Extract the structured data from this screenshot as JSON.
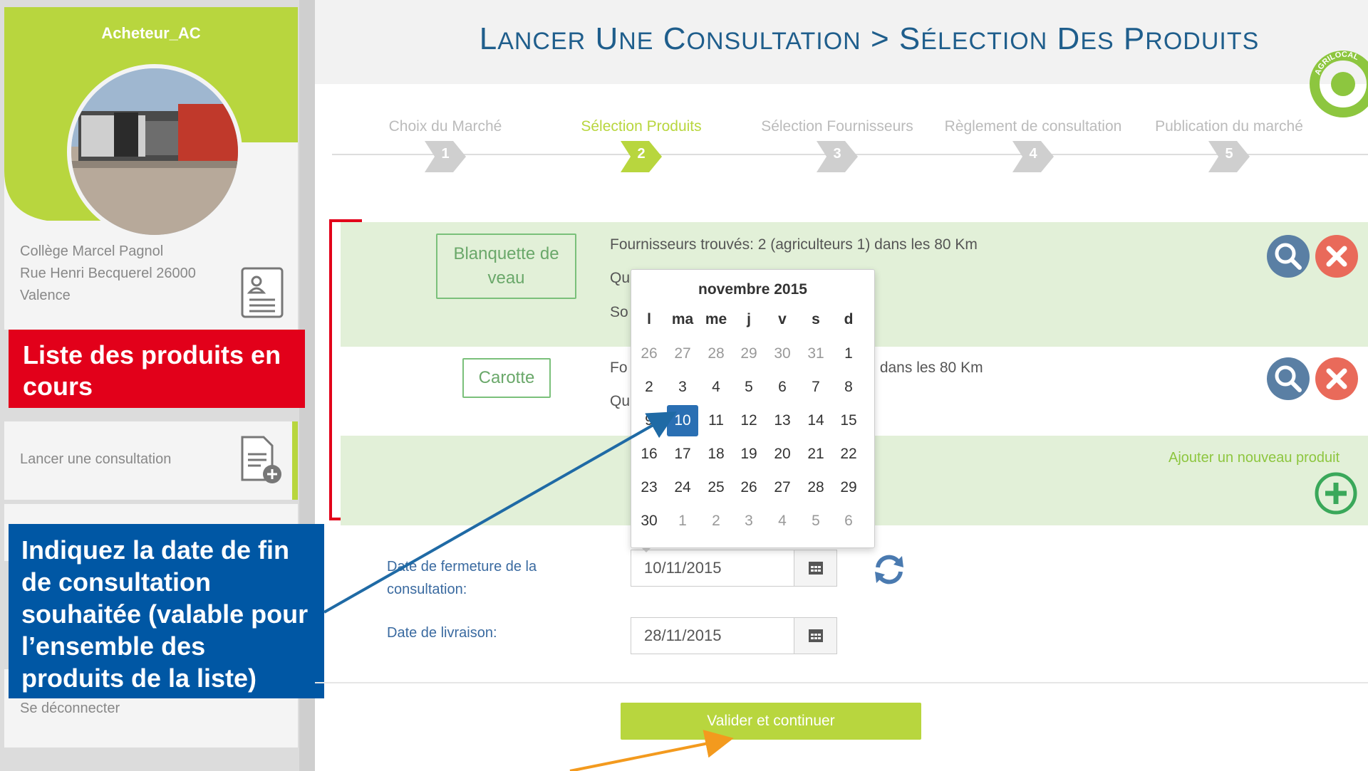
{
  "sidebar": {
    "user_name": "Acheteur_AC",
    "address_lines": [
      "Collège Marcel Pagnol",
      "Rue Henri Becquerel 26000",
      "Valence"
    ],
    "banner_text": "Liste des produits en cours",
    "nav_consult_label": "Lancer une consultation",
    "logout_label": "Se déconnecter"
  },
  "callout_text": "Indiquez la date de fin de consultation souhaitée (valable pour l’ensemble des produits de la liste)",
  "header": {
    "title_part1": "Lancer une consultation",
    "title_separator": ">",
    "title_part2": "Sélection des produits",
    "logo_text": "AGRILOCAL"
  },
  "stepper": [
    {
      "label": "Choix du Marché",
      "num": "1",
      "active": false
    },
    {
      "label": "Sélection Produits",
      "num": "2",
      "active": true
    },
    {
      "label": "Sélection Fournisseurs",
      "num": "3",
      "active": false
    },
    {
      "label": "Règlement de consultation",
      "num": "4",
      "active": false
    },
    {
      "label": "Publication du marché",
      "num": "5",
      "active": false
    }
  ],
  "products": [
    {
      "name": "Blanquette de veau",
      "suppliers": "Fournisseurs trouvés: 2 (agriculteurs 1) dans les 80 Km",
      "line2": "Qu",
      "line3": "So"
    },
    {
      "name": "Carotte",
      "suppliers_start": "Fo",
      "suppliers_end": ") dans les 80 Km",
      "line2": "Qu"
    }
  ],
  "add_product_label": "Ajouter un nouveau produit",
  "form": {
    "close_date_label": "Date de fermeture de la consultation:",
    "close_date_value": "10/11/2015",
    "delivery_date_label": "Date de livraison:",
    "delivery_date_value": "28/11/2015",
    "submit_label": "Valider et continuer"
  },
  "calendar": {
    "month": "novembre 2015",
    "weekdays": [
      "l",
      "ma",
      "me",
      "j",
      "v",
      "s",
      "d"
    ],
    "weeks": [
      [
        "26",
        "27",
        "28",
        "29",
        "30",
        "31",
        "1"
      ],
      [
        "2",
        "3",
        "4",
        "5",
        "6",
        "7",
        "8"
      ],
      [
        "9",
        "10",
        "11",
        "12",
        "13",
        "14",
        "15"
      ],
      [
        "16",
        "17",
        "18",
        "19",
        "20",
        "21",
        "22"
      ],
      [
        "23",
        "24",
        "25",
        "26",
        "27",
        "28",
        "29"
      ],
      [
        "30",
        "1",
        "2",
        "3",
        "4",
        "5",
        "6"
      ]
    ],
    "selected_day": "10"
  },
  "colors": {
    "brand_green": "#b8d63e",
    "title_blue": "#1f5e8c",
    "banner_red": "#e2001a",
    "callout_blue": "#0057a4",
    "row_green": "#e2f0d8",
    "search_blue": "#5a7fa4",
    "close_red": "#e96a5a",
    "arrow_blue": "#1f6aa5",
    "arrow_orange": "#f39a1e"
  },
  "icons": [
    "vcard-icon",
    "add-document-icon",
    "calendar-icon",
    "refresh-icon",
    "search-icon",
    "close-icon",
    "add-circle-icon"
  ]
}
